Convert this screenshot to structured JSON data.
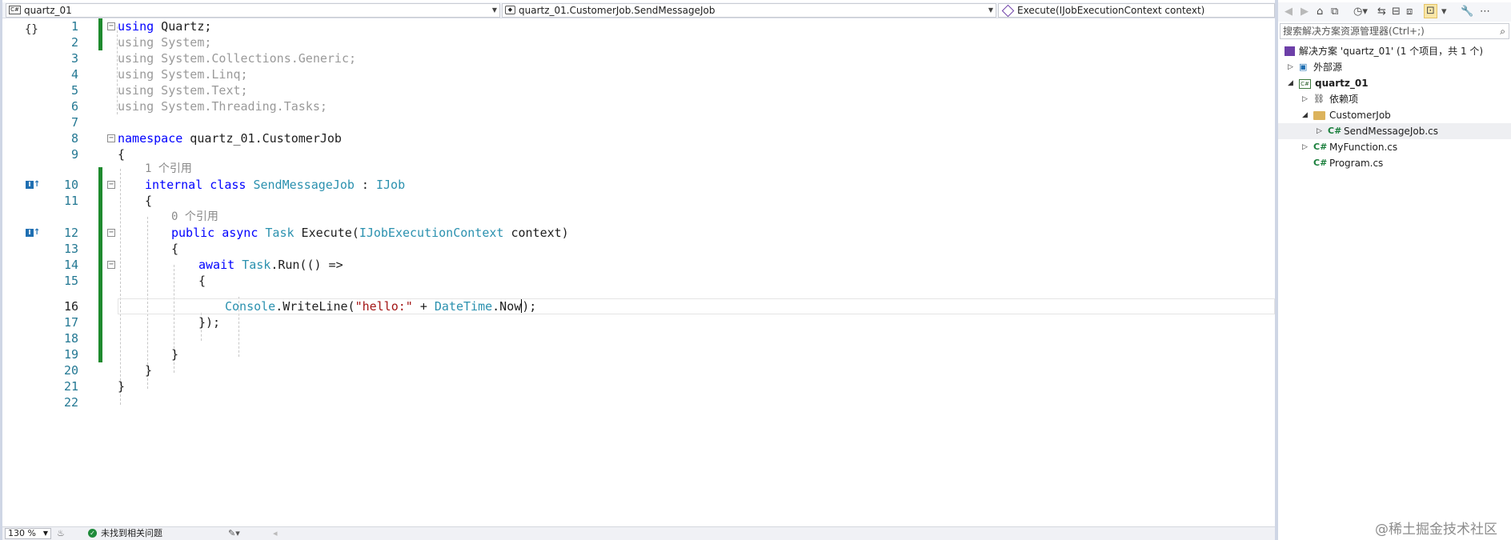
{
  "navbar": {
    "project": "quartz_01",
    "class": "quartz_01.CustomerJob.SendMessageJob",
    "member": "Execute(IJobExecutionContext context)"
  },
  "editor": {
    "line_numbers": [
      "1",
      "2",
      "3",
      "4",
      "5",
      "6",
      "7",
      "8",
      "9",
      "10",
      "11",
      "12",
      "13",
      "14",
      "15",
      "16",
      "17",
      "18",
      "19",
      "20",
      "21",
      "22"
    ],
    "code": {
      "l1_using": "using",
      "l1_ns": " Quartz;",
      "l2": "using System;",
      "l3": "using System.Collections.Generic;",
      "l4": "using System.Linq;",
      "l5": "using System.Text;",
      "l6": "using System.Threading.Tasks;",
      "l8_kw": "namespace",
      "l8_rest": " quartz_01.CustomerJob",
      "l9": "{",
      "lens1": "1 个引用",
      "l10_kw": "internal class ",
      "l10_type": "SendMessageJob",
      "l10_colon": " : ",
      "l10_iface": "IJob",
      "l11": "{",
      "lens2": "0 个引用",
      "l12_kw": "public async ",
      "l12_type": "Task",
      "l12_name": " Execute(",
      "l12_ptype": "IJobExecutionContext",
      "l12_rest": " context)",
      "l13": "{",
      "l14_kw": "await ",
      "l14_type": "Task",
      "l14_rest": ".Run(() =>",
      "l15": "{",
      "l16_type1": "Console",
      "l16_a": ".WriteLine(",
      "l16_str": "\"hello:\"",
      "l16_b": " + ",
      "l16_type2": "DateTime",
      "l16_c": ".Now",
      "l16_d": ");",
      "l17": "});",
      "l19": "}",
      "l20": "}",
      "l21": "}"
    }
  },
  "status": {
    "zoom": "130 %",
    "issues": "未找到相关问题"
  },
  "solution_explorer": {
    "search_placeholder": "搜索解决方案资源管理器(Ctrl+;)",
    "solution": "解决方案 'quartz_01' (1 个项目，共 1 个)",
    "external": "外部源",
    "project": "quartz_01",
    "dependencies": "依赖项",
    "folder": "CustomerJob",
    "file_selected": "SendMessageJob.cs",
    "file2": "MyFunction.cs",
    "file3": "Program.cs"
  },
  "watermark": "@稀土掘金技术社区"
}
